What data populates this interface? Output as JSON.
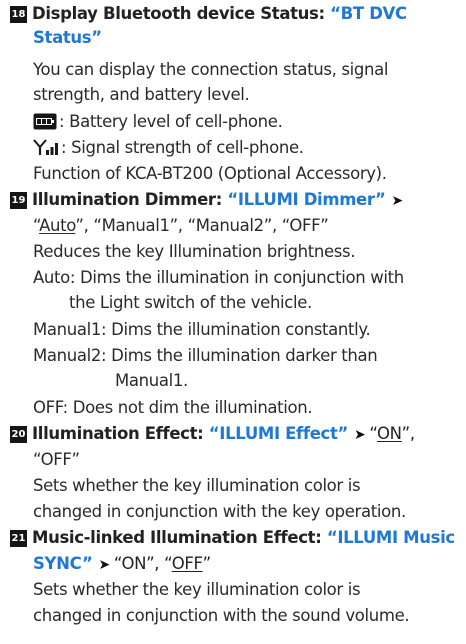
{
  "items": {
    "i18": {
      "num": "18",
      "title": "Display Bluetooth device Status:",
      "setting_l1": "“BT DVC",
      "setting_l2": "Status”",
      "desc_l1": "You can display the connection status, signal",
      "desc_l2": "strength, and battery level.",
      "battery_text": ": Battery level of cell-phone.",
      "signal_text": ": Signal strength of cell-phone.",
      "note": "Function of KCA-BT200 (Optional Accessory)."
    },
    "i19": {
      "num": "19",
      "title": "Illumination Dimmer:",
      "setting": "“ILLUMI Dimmer”",
      "opt_default": "Auto",
      "opt_rest": ", “Manual1”, “Manual2”, “OFF”",
      "desc": "Reduces the key Illumination brightness.",
      "auto_l1": "Auto: Dims the illumination in conjunction with",
      "auto_l2": "the Light switch of the vehicle.",
      "manual1": "Manual1: Dims the illumination constantly.",
      "manual2_l1": "Manual2: Dims the illumination darker than",
      "manual2_l2": "Manual1.",
      "off": "OFF: Does not dim the illumination."
    },
    "i20": {
      "num": "20",
      "title": "Illumination Effect:",
      "setting": "“ILLUMI Effect”",
      "opt_default": "ON",
      "opt_off": "“OFF”",
      "desc_l1": "Sets whether the key illumination color is",
      "desc_l2": "changed in conjunction with the key operation."
    },
    "i21": {
      "num": "21",
      "title": "Music-linked Illumination Effect:",
      "setting_l1": "“ILLUMI Music",
      "setting_l2": "SYNC”",
      "opt_on": "“ON”, ",
      "opt_default": "OFF",
      "desc_l1": "Sets whether the key illumination color is",
      "desc_l2": "changed in conjunction with the sound volume."
    }
  },
  "symbols": {
    "arrow": "➤",
    "comma": ",",
    "open_quote": "“",
    "close_quote": "”"
  },
  "icons": {
    "battery": "battery-icon",
    "signal": "signal-strength-icon"
  },
  "colors": {
    "setting_name": "#1f78d1",
    "badge_bg": "#151515",
    "body_text": "#2a2a2a"
  }
}
